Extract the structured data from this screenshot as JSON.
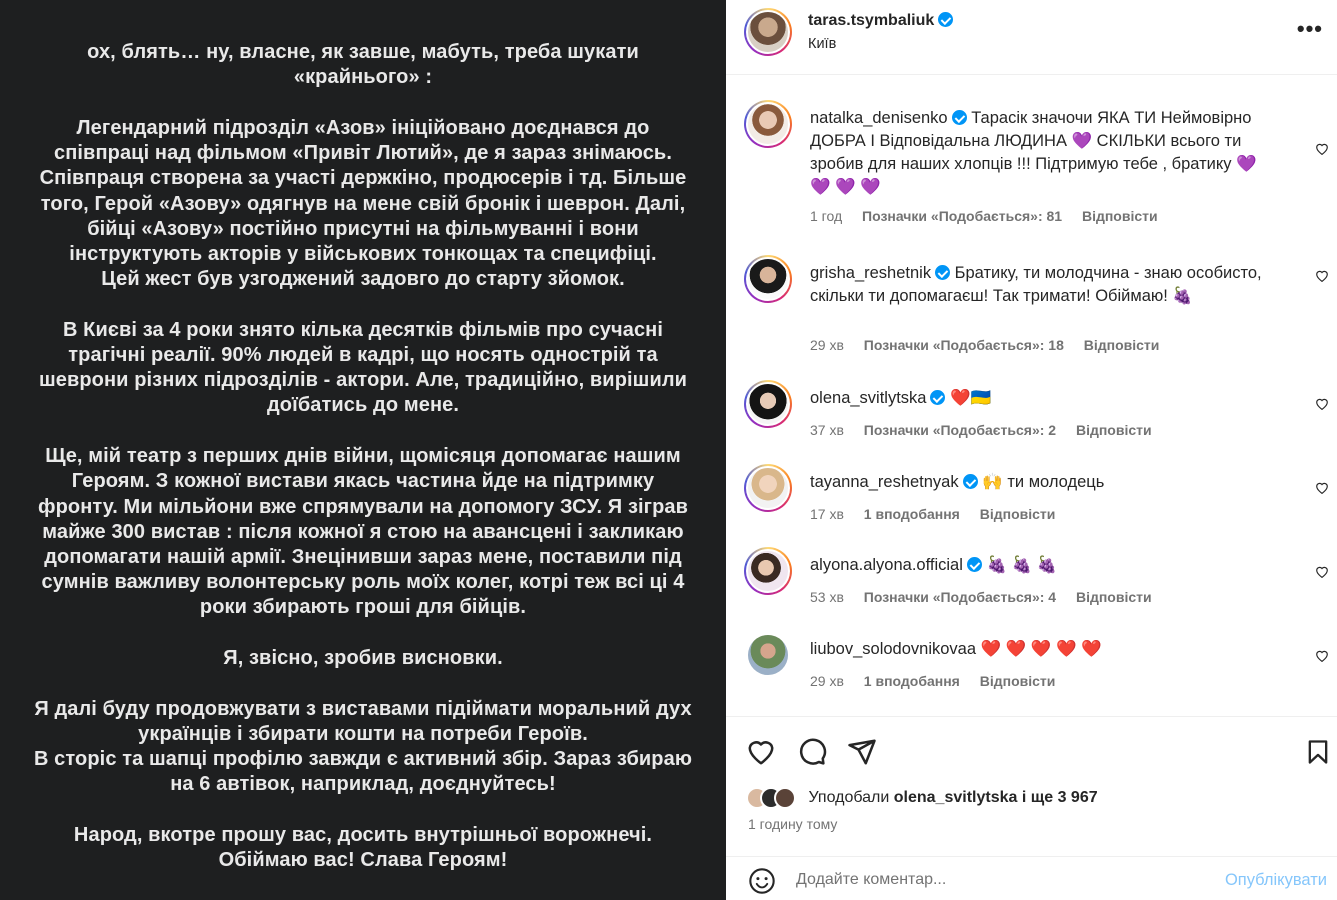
{
  "post": {
    "text_paragraphs": [
      "ох, блять… ну, власне, як завше, мабуть, треба шукати\n«крайнього» :",
      "Легендарний підрозділ «Азов» ініційовано доєднався до\nспівпраці над фільмом «Привіт Лютий», де я зараз знімаюсь.\nСпівпраця створена за участі держкіно, продюсерів і тд. Більше\nтого, Герой «Азову» одягнув на мене свій бронік і шеврон. Далі,\nбійці «Азову» постійно присутні на фільмуванні і вони\nінструктують акторів у військових тонкощах та специфіці.\nЦей жест був узгоджений задовго до старту зйомок.",
      "В Києві за 4 роки знято кілька десятків фільмів про сучасні\nтрагічні реалії. 90% людей в кадрі, що носять однострій та\nшеврони різних підрозділів - актори. Але, традиційно, вирішили\nдоїбатись до мене.",
      "Ще, мій театр з перших днів війни, щомісяця допомагає нашим\nГероям. З кожної вистави якась частина йде на підтримку\nфронту. Ми мільйони вже спрямували на допомогу ЗСУ. Я зіграв\nмайже 300 вистав : після кожної я стою на авансцені і закликаю\nдопомагати нашій армії. Знецінивши зараз мене, поставили під\nсумнів важливу волонтерську роль моїх колег, котрі теж всі ці 4\nроки збирають гроші для бійців.",
      "Я, звісно, зробив висновки.",
      "Я далі буду продовжувати з виставами підіймати моральний дух\nукраїнців і збирати кошти на потреби Героїв.\nВ сторіс та шапці профілю завжди є активний збір. Зараз збираю\nна 6 автівок, наприклад, доєднуйтесь!",
      "Народ, вкотре прошу вас, досить внутрішньої ворожнечі.\nОбіймаю вас! Слава Героям!"
    ]
  },
  "header": {
    "username": "taras.tsymbaliuk",
    "location": "Київ",
    "more_label": "•••"
  },
  "comments": [
    {
      "username": "natalka_denisenko",
      "verified": true,
      "text": "Тарасік значочи ЯКА ТИ Неймовірно ДОБРА І Відповідальна ЛЮДИНА 💜 СКІЛЬКИ всього ти зробив для наших хлопців !!! Підтримую тебе , братику 💜 💜 💜 💜",
      "time": "1 год",
      "likes": "Позначки «Подобається»: 81",
      "reply": "Відповісти"
    },
    {
      "username": "grisha_reshetnik",
      "verified": true,
      "text": "Братику, ти молодчина - знаю особисто, скільки ти допомагаєш! Так тримати! Обіймаю! 🍇",
      "time": "29 хв",
      "likes": "Позначки «Подобається»: 18",
      "reply": "Відповісти"
    },
    {
      "username": "olena_svitlytska",
      "verified": true,
      "text": "❤️🇺🇦",
      "time": "37 хв",
      "likes": "Позначки «Подобається»: 2",
      "reply": "Відповісти"
    },
    {
      "username": "tayanna_reshetnyak",
      "verified": true,
      "text": "🙌 ти молодець",
      "time": "17 хв",
      "likes": "1 вподобання",
      "reply": "Відповісти"
    },
    {
      "username": "alyona.alyona.official",
      "verified": true,
      "text": "🍇 🍇 🍇",
      "time": "53 хв",
      "likes": "Позначки «Подобається»: 4",
      "reply": "Відповісти"
    },
    {
      "username": "liubov_solodovnikovaa",
      "verified": false,
      "text": "❤️ ❤️ ❤️ ❤️ ❤️",
      "time": "29 хв",
      "likes": "1 вподобання",
      "reply": "Відповісти"
    }
  ],
  "footer": {
    "liked_by_prefix": "Уподобали",
    "liked_by_user": "olena_svitlytska",
    "liked_by_suffix": "і ще 3 967",
    "time_ago": "1 годину тому",
    "comment_placeholder": "Додайте коментар...",
    "publish_label": "Опублікувати"
  },
  "colors": {
    "media_bg": "#1e1f20",
    "verified": "#0095f6",
    "publish": "#85c6fb",
    "muted": "#737373"
  },
  "icons": [
    "heart-icon",
    "comment-icon",
    "share-icon",
    "bookmark-icon",
    "smile-icon",
    "more-icon"
  ]
}
